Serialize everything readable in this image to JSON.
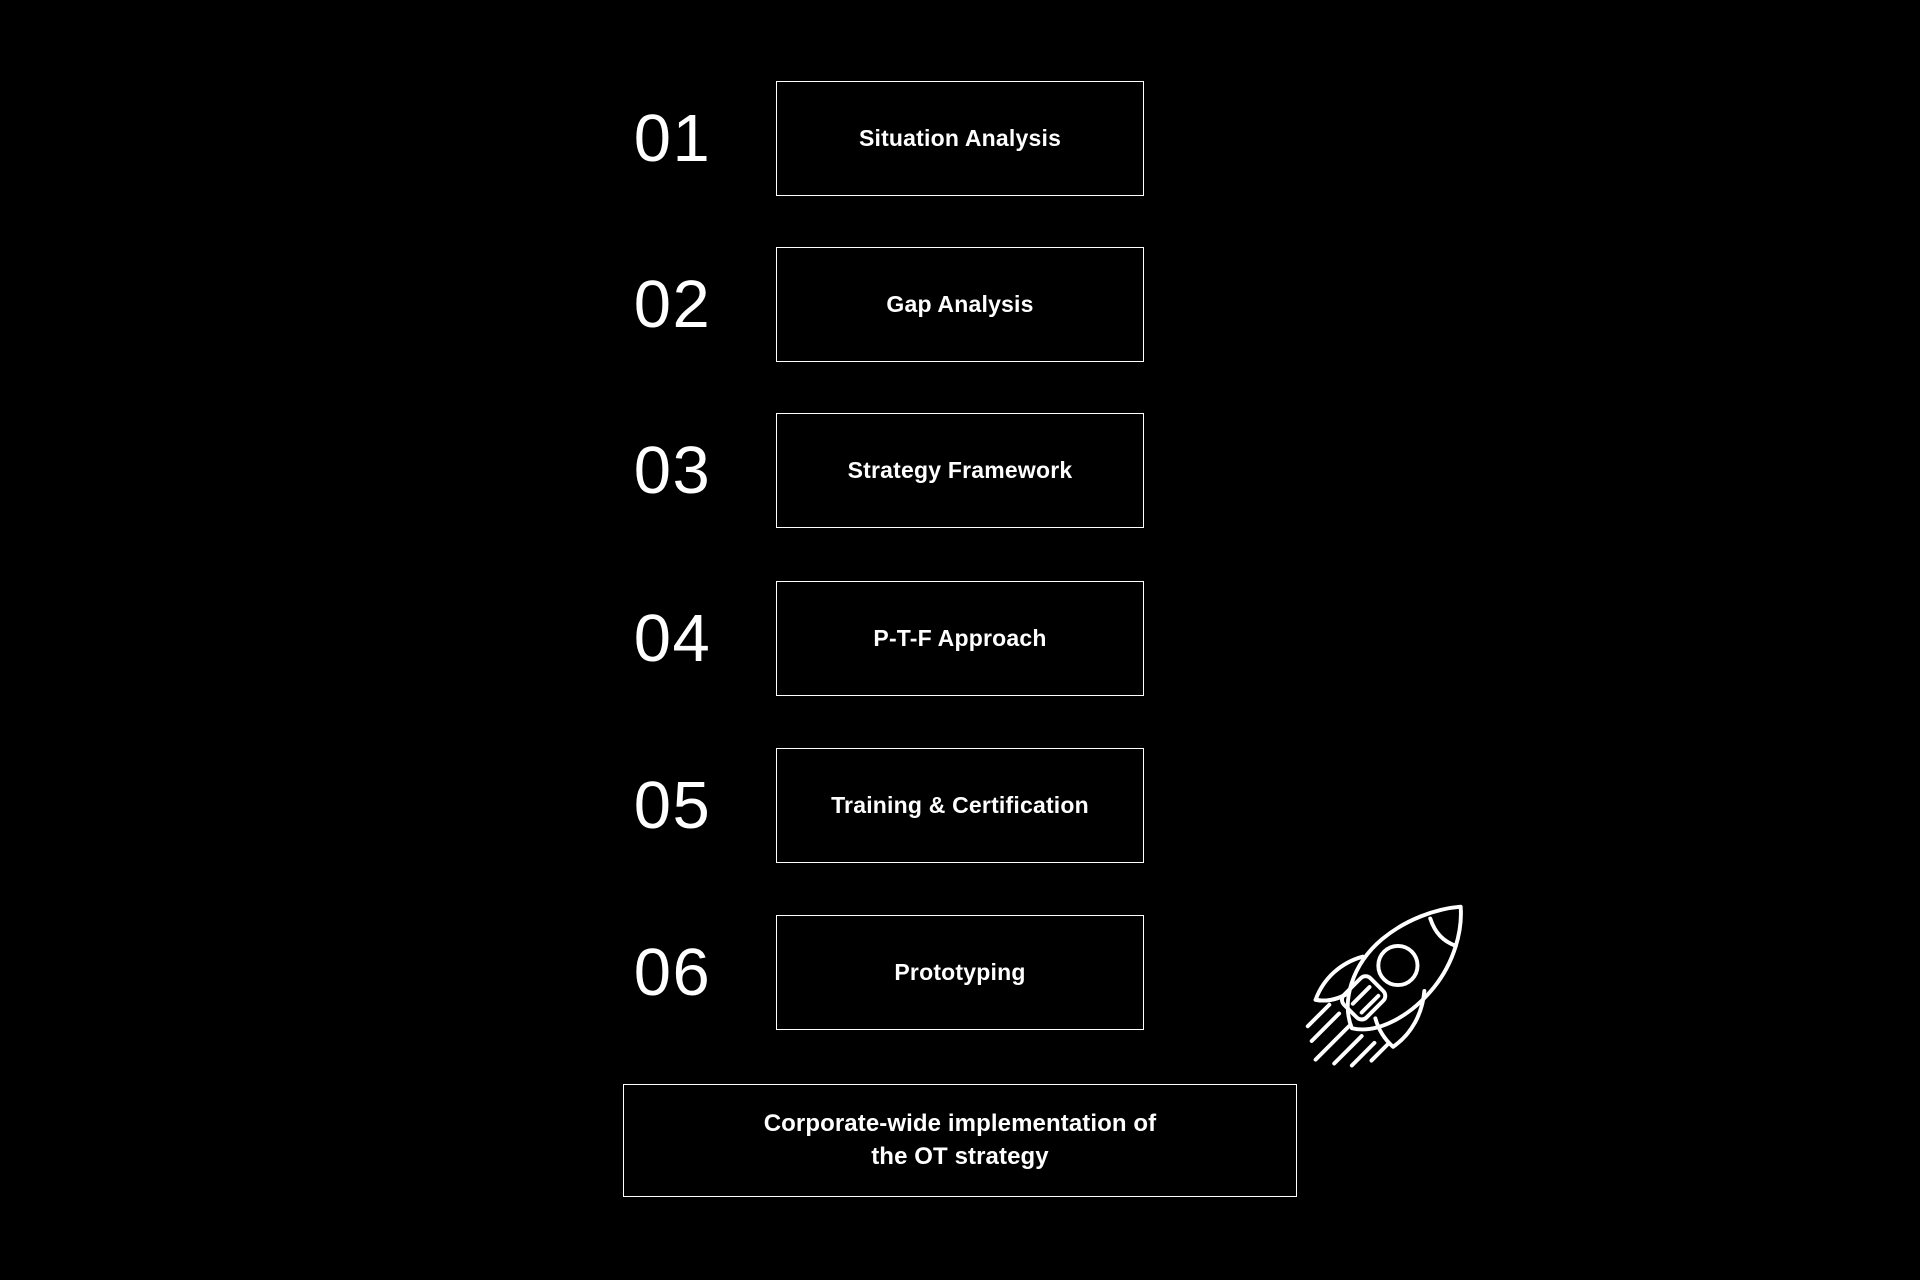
{
  "page": {
    "background_color": "#000000",
    "foreground_color": "#ffffff"
  },
  "steps": [
    {
      "number": "01",
      "label": "Situation Analysis"
    },
    {
      "number": "02",
      "label": "Gap Analysis"
    },
    {
      "number": "03",
      "label": "Strategy Framework"
    },
    {
      "number": "04",
      "label": "P-T-F Approach"
    },
    {
      "number": "05",
      "label": "Training & Certification"
    },
    {
      "number": "06",
      "label": "Prototyping"
    }
  ],
  "summary": {
    "text": "Corporate-wide implementation of\nthe OT strategy"
  },
  "decoration": {
    "icon": "rocket-icon"
  }
}
